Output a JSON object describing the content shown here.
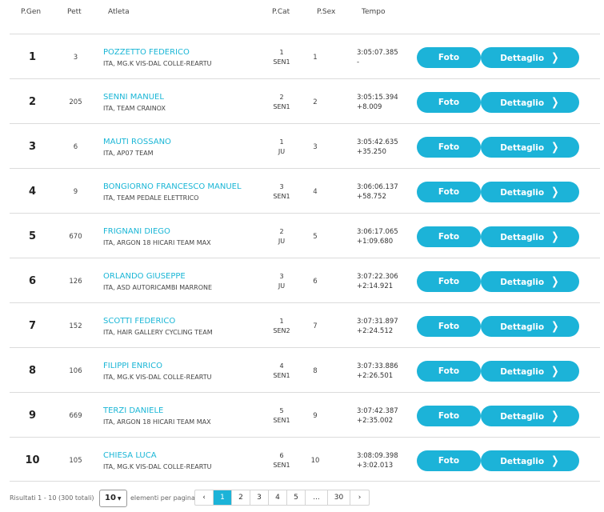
{
  "headers": {
    "pgen": "P.Gen",
    "pett": "Pett",
    "atleta": "Atleta",
    "pcat": "P.Cat",
    "psex": "P.Sex",
    "tempo": "Tempo"
  },
  "buttons": {
    "foto": "Foto",
    "dettaglio": "Dettaglio"
  },
  "rows": [
    {
      "pos": "1",
      "bib": "3",
      "name": "POZZETTO FEDERICO",
      "team": "ITA, MG.K VIS-DAL COLLE-REARTU",
      "cat_pos": "1",
      "cat": "SEN1",
      "sex_pos": "1",
      "time": "3:05:07.385",
      "gap": "-"
    },
    {
      "pos": "2",
      "bib": "205",
      "name": "SENNI MANUEL",
      "team": "ITA, TEAM CRAINOX",
      "cat_pos": "2",
      "cat": "SEN1",
      "sex_pos": "2",
      "time": "3:05:15.394",
      "gap": "+8.009"
    },
    {
      "pos": "3",
      "bib": "6",
      "name": "MAUTI ROSSANO",
      "team": "ITA, AP07 TEAM",
      "cat_pos": "1",
      "cat": "JU",
      "sex_pos": "3",
      "time": "3:05:42.635",
      "gap": "+35.250"
    },
    {
      "pos": "4",
      "bib": "9",
      "name": "BONGIORNO FRANCESCO MANUEL",
      "team": "ITA, TEAM PEDALE ELETTRICO",
      "cat_pos": "3",
      "cat": "SEN1",
      "sex_pos": "4",
      "time": "3:06:06.137",
      "gap": "+58.752"
    },
    {
      "pos": "5",
      "bib": "670",
      "name": "FRIGNANI DIEGO",
      "team": "ITA, ARGON 18 HICARI TEAM MAX",
      "cat_pos": "2",
      "cat": "JU",
      "sex_pos": "5",
      "time": "3:06:17.065",
      "gap": "+1:09.680"
    },
    {
      "pos": "6",
      "bib": "126",
      "name": "ORLANDO GIUSEPPE",
      "team": "ITA, ASD AUTORICAMBI MARRONE",
      "cat_pos": "3",
      "cat": "JU",
      "sex_pos": "6",
      "time": "3:07:22.306",
      "gap": "+2:14.921"
    },
    {
      "pos": "7",
      "bib": "152",
      "name": "SCOTTI FEDERICO",
      "team": "ITA, HAIR GALLERY CYCLING TEAM",
      "cat_pos": "1",
      "cat": "SEN2",
      "sex_pos": "7",
      "time": "3:07:31.897",
      "gap": "+2:24.512"
    },
    {
      "pos": "8",
      "bib": "106",
      "name": "FILIPPI ENRICO",
      "team": "ITA, MG.K VIS-DAL COLLE-REARTU",
      "cat_pos": "4",
      "cat": "SEN1",
      "sex_pos": "8",
      "time": "3:07:33.886",
      "gap": "+2:26.501"
    },
    {
      "pos": "9",
      "bib": "669",
      "name": "TERZI DANIELE",
      "team": "ITA, ARGON 18 HICARI TEAM MAX",
      "cat_pos": "5",
      "cat": "SEN1",
      "sex_pos": "9",
      "time": "3:07:42.387",
      "gap": "+2:35.002"
    },
    {
      "pos": "10",
      "bib": "105",
      "name": "CHIESA LUCA",
      "team": "ITA, MG.K VIS-DAL COLLE-REARTU",
      "cat_pos": "6",
      "cat": "SEN1",
      "sex_pos": "10",
      "time": "3:08:09.398",
      "gap": "+3:02.013"
    }
  ],
  "footer": {
    "results_info": "Risultati 1 - 10 (300 totali)",
    "page_size": "10",
    "per_page_label": "elementi per pagina",
    "pages": [
      "‹",
      "1",
      "2",
      "3",
      "4",
      "5",
      "...",
      "30",
      "›"
    ],
    "active_page": "1"
  },
  "colors": {
    "accent": "#1cb3d8",
    "name_link": "#1ab6d6"
  }
}
